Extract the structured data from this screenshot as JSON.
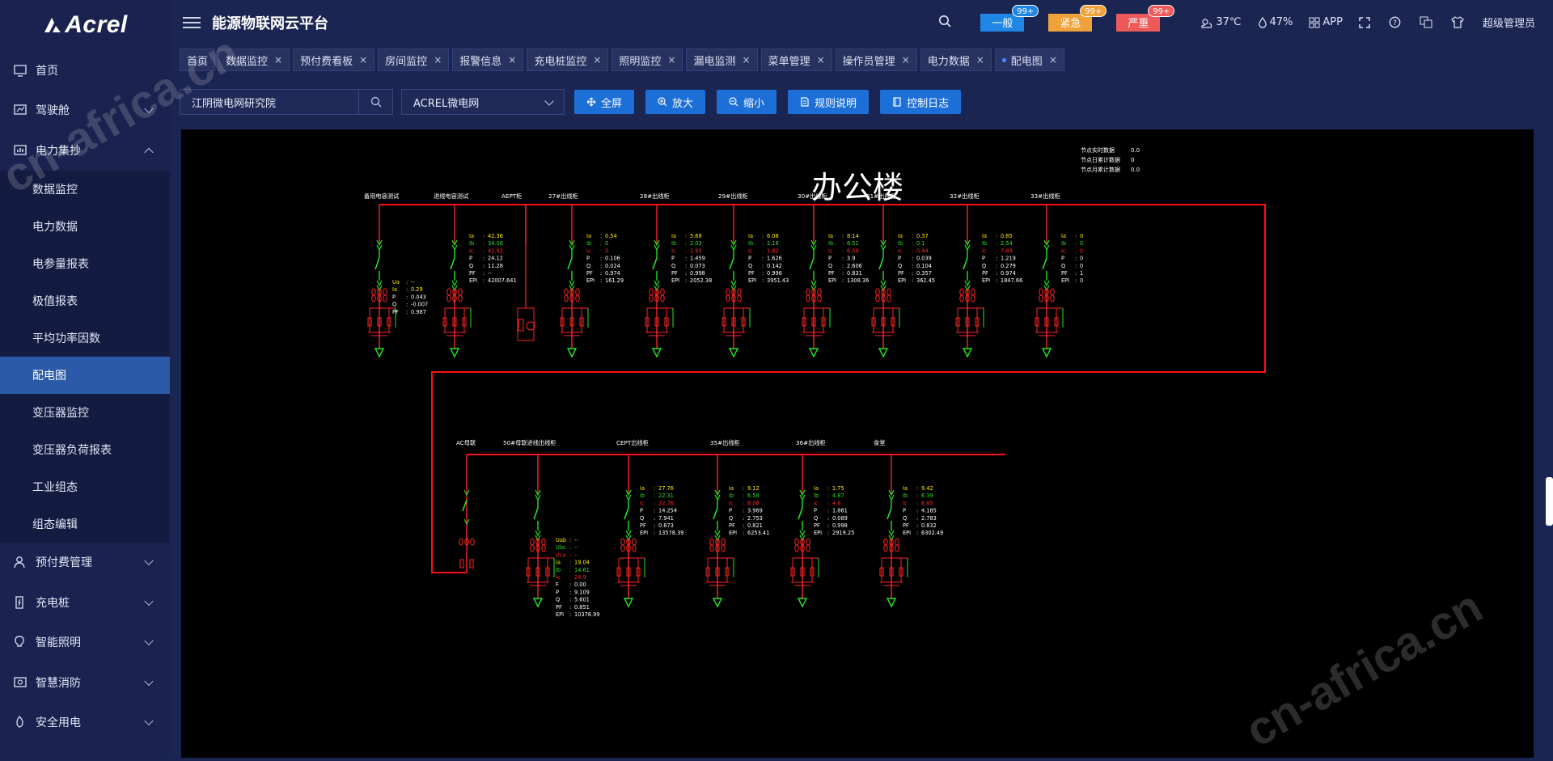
{
  "app": {
    "logo_text": "Acrel",
    "title": "能源物联网云平台"
  },
  "sidebar": [
    {
      "label": "首页",
      "icon": "monitor-icon",
      "expandable": false
    },
    {
      "label": "驾驶舱",
      "icon": "dashboard-icon",
      "expandable": true
    },
    {
      "label": "电力集抄",
      "icon": "chart-icon",
      "expandable": true,
      "expanded": true
    },
    {
      "label": "数据监控",
      "sub": true
    },
    {
      "label": "电力数据",
      "sub": true
    },
    {
      "label": "电参量报表",
      "sub": true
    },
    {
      "label": "极值报表",
      "sub": true
    },
    {
      "label": "平均功率因数",
      "sub": true
    },
    {
      "label": "配电图",
      "sub": true,
      "active": true
    },
    {
      "label": "变压器监控",
      "sub": true
    },
    {
      "label": "变压器负荷报表",
      "sub": true
    },
    {
      "label": "工业组态",
      "sub": true
    },
    {
      "label": "组态编辑",
      "sub": true
    },
    {
      "label": "预付费管理",
      "icon": "user-icon",
      "expandable": true
    },
    {
      "label": "充电桩",
      "icon": "charger-icon",
      "expandable": true
    },
    {
      "label": "智能照明",
      "icon": "bulb-icon",
      "expandable": true
    },
    {
      "label": "智慧消防",
      "icon": "fire-icon",
      "expandable": true
    },
    {
      "label": "安全用电",
      "icon": "shield-icon",
      "expandable": true
    }
  ],
  "alarms": [
    {
      "label": "一般",
      "count": "99+",
      "color": "#1f86e6",
      "badge": "#1f86e6"
    },
    {
      "label": "紧急",
      "count": "99+",
      "color": "#f0a23a",
      "badge": "#f0a23a"
    },
    {
      "label": "严重",
      "count": "99+",
      "color": "#ee5a5a",
      "badge": "#ee5a5a"
    }
  ],
  "weather": {
    "temp": "37℃",
    "humidity": "47%"
  },
  "header": {
    "app_label": "APP",
    "user": "超级管理员"
  },
  "tabs": [
    {
      "label": "首页",
      "closable": false
    },
    {
      "label": "数据监控",
      "closable": true
    },
    {
      "label": "预付费看板",
      "closable": true
    },
    {
      "label": "房间监控",
      "closable": true
    },
    {
      "label": "报警信息",
      "closable": true
    },
    {
      "label": "充电桩监控",
      "closable": true
    },
    {
      "label": "照明监控",
      "closable": true
    },
    {
      "label": "漏电监测",
      "closable": true
    },
    {
      "label": "菜单管理",
      "closable": true
    },
    {
      "label": "操作员管理",
      "closable": true
    },
    {
      "label": "电力数据",
      "closable": true
    },
    {
      "label": "配电图",
      "closable": true,
      "active": true
    }
  ],
  "toolbar": {
    "site": "江阴微电网研究院",
    "network": "ACREL微电网",
    "buttons": [
      {
        "label": "全屏",
        "icon": "move-icon"
      },
      {
        "label": "放大",
        "icon": "zoom-in-icon"
      },
      {
        "label": "缩小",
        "icon": "zoom-out-icon"
      },
      {
        "label": "规则说明",
        "icon": "document-icon"
      },
      {
        "label": "控制日志",
        "icon": "log-icon"
      }
    ]
  },
  "diagram": {
    "title": "办公楼",
    "stats": [
      {
        "label": "节点实时数据",
        "value": "0.0"
      },
      {
        "label": "节点日累计数据",
        "value": "0"
      },
      {
        "label": "节点月累计数据",
        "value": "0.0"
      }
    ],
    "row1": [
      {
        "name": "备用电容测试",
        "kind": "cap",
        "vals": {
          "Ua": "--",
          "Ia": "0.29",
          "P": "0.043",
          "Q": "-0.007",
          "PF": "0.987"
        }
      },
      {
        "name": "进线电容测试",
        "kind": "feeder",
        "vals": {
          "Ia": "42.36",
          "Ib": "34.08",
          "Ic": "42.92",
          "P": "24.12",
          "Q": "11.28",
          "PF": "--",
          "EPI": "42007.641"
        }
      },
      {
        "name": "AEPT柜",
        "kind": "pt",
        "vals": {}
      },
      {
        "name": "27#出线柜",
        "kind": "feeder",
        "vals": {
          "Ia": "0.54",
          "Ib": "0",
          "Ic": "0",
          "P": "0.106",
          "Q": "0.024",
          "PF": "0.974",
          "EPI": "161.29"
        }
      },
      {
        "name": "28#出线柜",
        "kind": "feeder",
        "vals": {
          "Ia": "5.68",
          "Ib": "2.03",
          "Ic": "1.95",
          "P": "1.459",
          "Q": "0.073",
          "PF": "0.998",
          "EPI": "2052.38"
        }
      },
      {
        "name": "29#出线柜",
        "kind": "feeder",
        "vals": {
          "Ia": "6.08",
          "Ib": "2.18",
          "Ic": "1.82",
          "P": "1.626",
          "Q": "0.142",
          "PF": "0.996",
          "EPI": "3951.43"
        }
      },
      {
        "name": "30#出线柜",
        "kind": "feeder",
        "vals": {
          "Ia": "8.14",
          "Ib": "6.51",
          "Ic": "6.59",
          "P": "3.9",
          "Q": "2.606",
          "PF": "0.831",
          "EPI": "1308.36"
        }
      },
      {
        "name": "31#出线柜",
        "kind": "feeder",
        "vals": {
          "Ia": "0.37",
          "Ib": "0.1",
          "Ic": "0.44",
          "P": "0.039",
          "Q": "0.104",
          "PF": "0.357",
          "EPI": "362.45"
        }
      },
      {
        "name": "32#出线柜",
        "kind": "feeder",
        "vals": {
          "Ia": "0.85",
          "Ib": "2.54",
          "Ic": "7.84",
          "P": "1.219",
          "Q": "0.279",
          "PF": "0.974",
          "EPI": "1847.66"
        }
      },
      {
        "name": "33#出线柜",
        "kind": "feeder",
        "vals": {
          "Ia": "0",
          "Ib": "0",
          "Ic": "0",
          "P": "0",
          "Q": "0",
          "PF": "1",
          "EPI": "0"
        }
      }
    ],
    "row2": [
      {
        "name": "AC母联",
        "kind": "tie",
        "vals": {}
      },
      {
        "name": "50#母联进线出线柜",
        "kind": "incoming",
        "vals": {
          "Uab": "--",
          "Ubc": "--",
          "Uca": "--",
          "Ia": "19.04",
          "Ib": "14.61",
          "Ic": "24.9",
          "F": "0.00",
          "P": "9.109",
          "Q": "5.601",
          "PF": "0.851",
          "EPI": "10378.99"
        }
      },
      {
        "name": "CEPT出线柜",
        "kind": "feeder",
        "vals": {
          "Ia": "27.76",
          "Ib": "22.31",
          "Ic": "22.76",
          "P": "14.254",
          "Q": "7.941",
          "PF": "0.873",
          "EPI": "13578.39"
        }
      },
      {
        "name": "35#出线柜",
        "kind": "feeder",
        "vals": {
          "Ia": "9.12",
          "Ib": "6.58",
          "Ic": "6.06",
          "P": "3.969",
          "Q": "2.753",
          "PF": "0.821",
          "EPI": "6253.41"
        }
      },
      {
        "name": "36#出线柜",
        "kind": "feeder",
        "vals": {
          "Ia": "1.75",
          "Ib": "4.87",
          "Ic": "4.6",
          "P": "1.861",
          "Q": "0.089",
          "PF": "0.998",
          "EPI": "2919.25"
        }
      },
      {
        "name": "食堂",
        "kind": "feeder",
        "vals": {
          "Ia": "9.42",
          "Ib": "6.39",
          "Ic": "6.85",
          "P": "4.185",
          "Q": "2.783",
          "PF": "0.832",
          "EPI": "6302.49"
        }
      }
    ]
  },
  "watermark": "cn-africa.cn",
  "colors": {
    "bus": "#ff1010",
    "device": "#ff2424",
    "switch": "#22e622",
    "Ia": "#ffee00",
    "Ib": "#33dd33",
    "Ic": "#ff2a2a",
    "value": "#ffffff"
  }
}
